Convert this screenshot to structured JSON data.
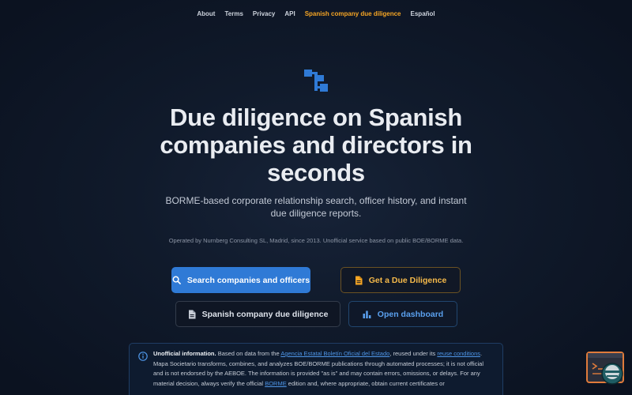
{
  "nav": {
    "items": [
      {
        "label": "About"
      },
      {
        "label": "Terms"
      },
      {
        "label": "Privacy"
      },
      {
        "label": "API"
      },
      {
        "label": "Spanish company due diligence",
        "active": true
      },
      {
        "label": "Español"
      }
    ]
  },
  "logo_icon": "org-chart-icon",
  "hero": {
    "headline": "Due diligence on Spanish companies and directors in seconds",
    "subhead": "BORME-based corporate relationship search, officer history, and instant due diligence reports.",
    "operated": "Operated by Nurnberg Consulting SL, Madrid, since 2013. Unofficial service based on public BOE/BORME data."
  },
  "buttons": {
    "search": {
      "label": "Search companies and officers",
      "icon": "search-icon"
    },
    "due_diligence": {
      "label": "Get a Due Diligence",
      "icon": "document-icon"
    },
    "spanish_dd": {
      "label": "Spanish company due diligence",
      "icon": "document-icon"
    },
    "dashboard": {
      "label": "Open dashboard",
      "icon": "bar-chart-icon"
    }
  },
  "notice": {
    "title": "Unofficial information.",
    "t1": "Based on data from the",
    "link_agency": "Agencia Estatal Boletín Oficial del Estado",
    "t2": ", reused under its",
    "link_reuse": "reuse conditions",
    "t3": ". Mapa Societario transforms, combines, and analyzes BOE/BORME publications through automated processes; it is not official and is not endorsed by the AEBOE. The information is provided \"as is\" and may contain errors, omissions, or delays. For any material decision, always verify the official",
    "link_borme": "BORME",
    "t4": "edition and, where appropriate, obtain current certificates or"
  },
  "colors": {
    "accent_blue": "#2f7ad6",
    "accent_amber": "#f5a524",
    "background": "#0b1220"
  }
}
